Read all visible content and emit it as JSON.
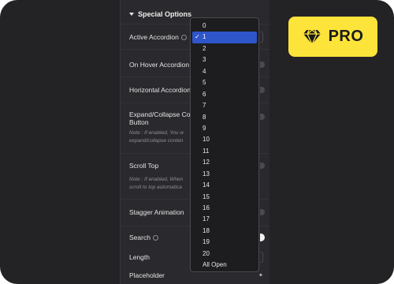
{
  "section": {
    "title": "Special Options"
  },
  "rows": {
    "active_accordion": "Active Accordion",
    "on_hover_accordion": "On Hover Accordion",
    "horizontal_accordion": "Horizontal Accordion",
    "expand_collapse_line1": "Expand/Collapse Cont",
    "expand_collapse_line2": "Button",
    "expand_note_line1": "Note : If enabled, You w",
    "expand_note_line2": "expand/collapse conten",
    "scroll_top": "Scroll Top",
    "scroll_note_line1": "Note : If enabled, When",
    "scroll_note_line2": "scroll to top automatica",
    "stagger_animation": "Stagger Animation",
    "search": "Search",
    "length": "Length",
    "placeholder": "Placeholder"
  },
  "dropdown": {
    "selected": "1",
    "options": [
      "0",
      "1",
      "2",
      "3",
      "4",
      "5",
      "6",
      "7",
      "8",
      "9",
      "10",
      "11",
      "12",
      "13",
      "14",
      "15",
      "16",
      "17",
      "18",
      "19",
      "20",
      "All Open"
    ]
  },
  "badge": {
    "label": "PRO",
    "icon": "diamond-icon"
  },
  "colors": {
    "frame_bg": "#232326",
    "panel_bg": "#2a2a2e",
    "dropdown_bg": "#1d1d1f",
    "selected_bg": "#2e56c9",
    "badge_bg": "#fce43a"
  }
}
